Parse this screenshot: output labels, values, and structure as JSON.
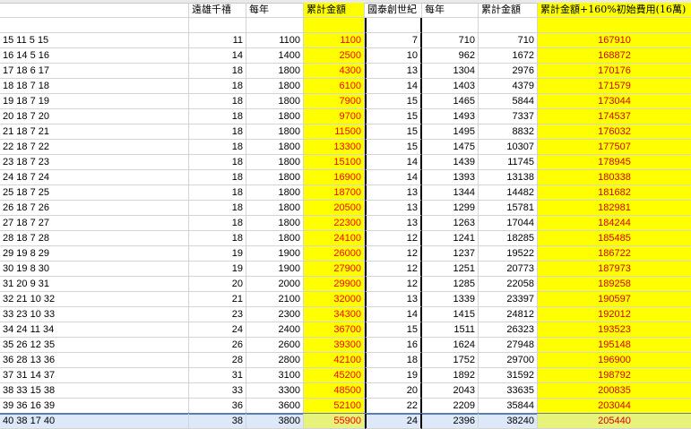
{
  "header": {
    "col_a": "",
    "col_b": "遠雄千禧",
    "col_c": "每年",
    "col_d": "累計金額",
    "col_e": "國泰創世紀",
    "col_f": "每年",
    "col_g": "累計金額",
    "col_h": "累計金額+160%初始費用(16萬)"
  },
  "rows": [
    [
      "",
      "",
      "",
      "",
      "",
      "",
      "",
      ""
    ],
    [
      "15 11 5 15",
      "11",
      "1100",
      "1100",
      "7",
      "710",
      "710",
      "167910"
    ],
    [
      "16 14 5 16",
      "14",
      "1400",
      "2500",
      "10",
      "962",
      "1672",
      "168872"
    ],
    [
      "17 18 6 17",
      "18",
      "1800",
      "4300",
      "13",
      "1304",
      "2976",
      "170176"
    ],
    [
      "18 18 7 18",
      "18",
      "1800",
      "6100",
      "14",
      "1403",
      "4379",
      "171579"
    ],
    [
      "19 18 7 19",
      "18",
      "1800",
      "7900",
      "15",
      "1465",
      "5844",
      "173044"
    ],
    [
      "20 18 7 20",
      "18",
      "1800",
      "9700",
      "15",
      "1493",
      "7337",
      "174537"
    ],
    [
      "21 18 7 21",
      "18",
      "1800",
      "11500",
      "15",
      "1495",
      "8832",
      "176032"
    ],
    [
      "22 18 7 22",
      "18",
      "1800",
      "13300",
      "15",
      "1475",
      "10307",
      "177507"
    ],
    [
      "23 18 7 23",
      "18",
      "1800",
      "15100",
      "14",
      "1439",
      "11745",
      "178945"
    ],
    [
      "24 18 7 24",
      "18",
      "1800",
      "16900",
      "14",
      "1393",
      "13138",
      "180338"
    ],
    [
      "25 18 7 25",
      "18",
      "1800",
      "18700",
      "13",
      "1344",
      "14482",
      "181682"
    ],
    [
      "26 18 7 26",
      "18",
      "1800",
      "20500",
      "13",
      "1299",
      "15781",
      "182981"
    ],
    [
      "27 18 7 27",
      "18",
      "1800",
      "22300",
      "13",
      "1263",
      "17044",
      "184244"
    ],
    [
      "28 18 7 28",
      "18",
      "1800",
      "24100",
      "12",
      "1241",
      "18285",
      "185485"
    ],
    [
      "29 19 8 29",
      "19",
      "1900",
      "26000",
      "12",
      "1237",
      "19522",
      "186722"
    ],
    [
      "30 19 8 30",
      "19",
      "1900",
      "27900",
      "12",
      "1251",
      "20773",
      "187973"
    ],
    [
      "31 20 9 31",
      "20",
      "2000",
      "29900",
      "12",
      "1285",
      "22058",
      "189258"
    ],
    [
      "32 21 10 32",
      "21",
      "2100",
      "32000",
      "13",
      "1339",
      "23397",
      "190597"
    ],
    [
      "33 23 10 33",
      "23",
      "2300",
      "34300",
      "14",
      "1415",
      "24812",
      "192012"
    ],
    [
      "34 24 11 34",
      "24",
      "2400",
      "36700",
      "15",
      "1511",
      "26323",
      "193523"
    ],
    [
      "35 26 12 35",
      "26",
      "2600",
      "39300",
      "16",
      "1624",
      "27948",
      "195148"
    ],
    [
      "36 28 13 36",
      "28",
      "2800",
      "42100",
      "18",
      "1752",
      "29700",
      "196900"
    ],
    [
      "37 31 14 37",
      "31",
      "3100",
      "45200",
      "19",
      "1892",
      "31592",
      "198792"
    ],
    [
      "38 33 15 38",
      "33",
      "3300",
      "48500",
      "20",
      "2043",
      "33635",
      "200835"
    ],
    [
      "39 36 16 39",
      "36",
      "3600",
      "52100",
      "22",
      "2209",
      "35844",
      "203044"
    ],
    [
      "40 38 17 40",
      "38",
      "3800",
      "55900",
      "24",
      "2396",
      "38240",
      "205440"
    ]
  ],
  "colors": {
    "highlight": "#ffff00",
    "value_red": "#ff0000",
    "selection": "#dde8f8"
  }
}
